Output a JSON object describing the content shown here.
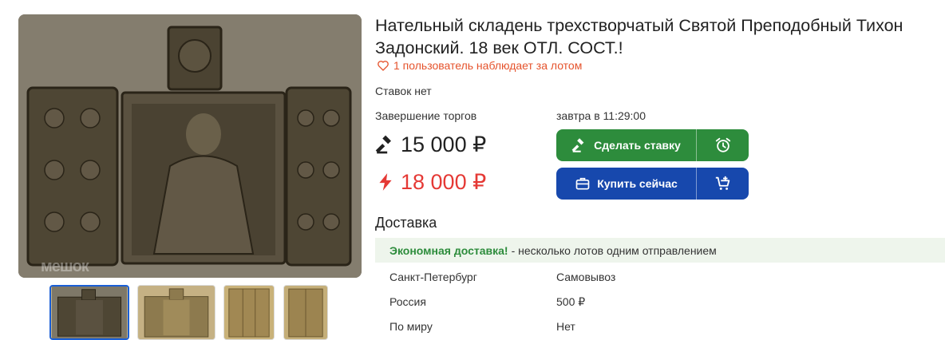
{
  "gallery": {
    "watermark": "мешок",
    "thumbnails": [
      "thumb-1",
      "thumb-2",
      "thumb-3",
      "thumb-4"
    ]
  },
  "lot": {
    "title": "Нательный складень трехстворчатый Святой Преподобный Тихон Задонский. 18 век ОТЛ. СОСТ.!",
    "watchers": "1 пользователь наблюдает за лотом",
    "bids": "Ставок нет",
    "end_label": "Завершение торгов",
    "end_value": "завтра в 11:29:00",
    "current_price": "15 000 ₽",
    "buynow_price": "18 000 ₽"
  },
  "actions": {
    "bid_label": "Сделать ставку",
    "buy_label": "Купить сейчас"
  },
  "delivery": {
    "title": "Доставка",
    "promo_highlight": "Экономная доставка!",
    "promo_text": "- несколько лотов одним отправлением",
    "rows": [
      {
        "region": "Санкт-Петербург",
        "cost": "Самовывоз"
      },
      {
        "region": "Россия",
        "cost": "500 ₽"
      },
      {
        "region": "По миру",
        "cost": "Нет"
      }
    ]
  },
  "colors": {
    "accent_orange": "#e5532c",
    "price_red": "#e53935",
    "bid_green": "#2d8c3c",
    "buy_blue": "#1748ad",
    "promo_bg": "#eef5ec"
  },
  "icons": {
    "watch": "heart-icon",
    "bid": "gavel-icon",
    "buynow": "lightning-icon",
    "reminder": "alarm-clock-icon",
    "buy": "briefcase-icon",
    "cart": "cart-plus-icon"
  }
}
